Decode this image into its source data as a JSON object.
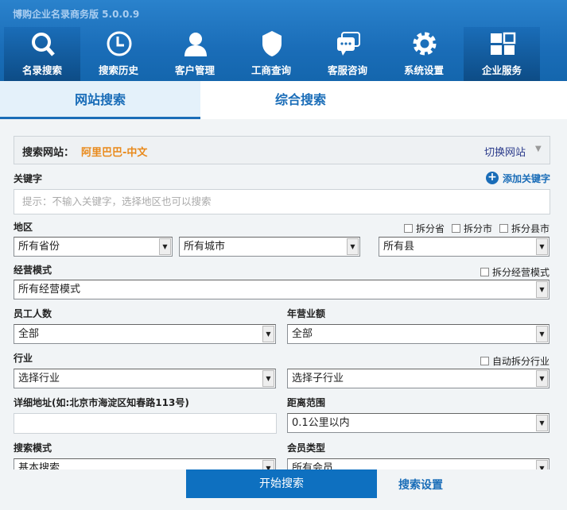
{
  "app_title": "博购企业名录商务版 5.0.0.9",
  "nav": [
    {
      "label": "名录搜索",
      "icon": "search-icon",
      "active": true
    },
    {
      "label": "搜索历史",
      "icon": "clock-icon"
    },
    {
      "label": "客户管理",
      "icon": "user-icon"
    },
    {
      "label": "工商查询",
      "icon": "shield-icon"
    },
    {
      "label": "客服咨询",
      "icon": "chat-icon"
    },
    {
      "label": "系统设置",
      "icon": "gear-icon"
    },
    {
      "label": "企业服务",
      "icon": "grid-icon",
      "active": true
    }
  ],
  "tabs": [
    {
      "label": "网站搜索",
      "active": true
    },
    {
      "label": "综合搜索"
    }
  ],
  "site": {
    "label": "搜索网站：",
    "value": "阿里巴巴-中文",
    "switch": "切换网站"
  },
  "keyword": {
    "label": "关键字",
    "add": "添加关键字",
    "placeholder": "提示：不输入关键字，选择地区也可以搜索"
  },
  "region": {
    "label": "地区",
    "split": [
      "拆分省",
      "拆分市",
      "拆分县市"
    ],
    "province": "所有省份",
    "city": "所有城市",
    "county": "所有县"
  },
  "mode": {
    "label": "经营模式",
    "split": "拆分经营模式",
    "value": "所有经营模式"
  },
  "staff": {
    "label": "员工人数",
    "value": "全部"
  },
  "revenue": {
    "label": "年营业额",
    "value": "全部"
  },
  "industry": {
    "label": "行业",
    "split": "自动拆分行业",
    "value": "选择行业",
    "sub": "选择子行业"
  },
  "address": {
    "label": "详细地址(如:北京市海淀区知春路113号)",
    "value": ""
  },
  "distance": {
    "label": "距离范围",
    "value": "0.1公里以内"
  },
  "search_mode": {
    "label": "搜索模式",
    "value": "基本搜索"
  },
  "member": {
    "label": "会员类型",
    "value": "所有会员"
  },
  "actions": {
    "start": "开始搜索",
    "settings": "搜索设置"
  },
  "colors": {
    "header": "#1a6db8",
    "accent_orange": "#e98a1c",
    "button": "#0e70c0"
  }
}
